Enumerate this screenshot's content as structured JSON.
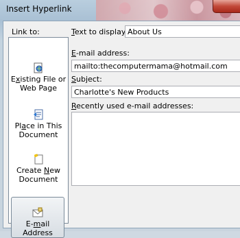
{
  "window": {
    "title": "Insert Hyperlink"
  },
  "link_to": {
    "label": "Link to:",
    "items": [
      {
        "pre": "E",
        "u": "x",
        "post": "isting File or",
        "line2": "Web Page",
        "icon": "globe-file-icon"
      },
      {
        "pre": "Pl",
        "u": "a",
        "post": "ce in This",
        "line2": "Document",
        "icon": "document-place-icon"
      },
      {
        "pre": "Create ",
        "u": "N",
        "post": "ew",
        "line2": "Document",
        "icon": "new-document-icon"
      },
      {
        "pre": "E-",
        "u": "m",
        "post": "ail Address",
        "line2": "",
        "icon": "email-icon",
        "selected": true
      }
    ]
  },
  "text_to_display": {
    "pre": "",
    "u": "T",
    "post": "ext to display:",
    "value": "About Us"
  },
  "email_address": {
    "pre": "",
    "u": "E",
    "post": "-mail address:",
    "value": "mailto:thecomputermama@hotmail.com"
  },
  "subject": {
    "pre": "",
    "u": "S",
    "post": "ubject:",
    "value": "Charlotte's New Products"
  },
  "recent": {
    "pre": "",
    "u": "R",
    "post": "ecently used e-mail addresses:",
    "items": []
  }
}
